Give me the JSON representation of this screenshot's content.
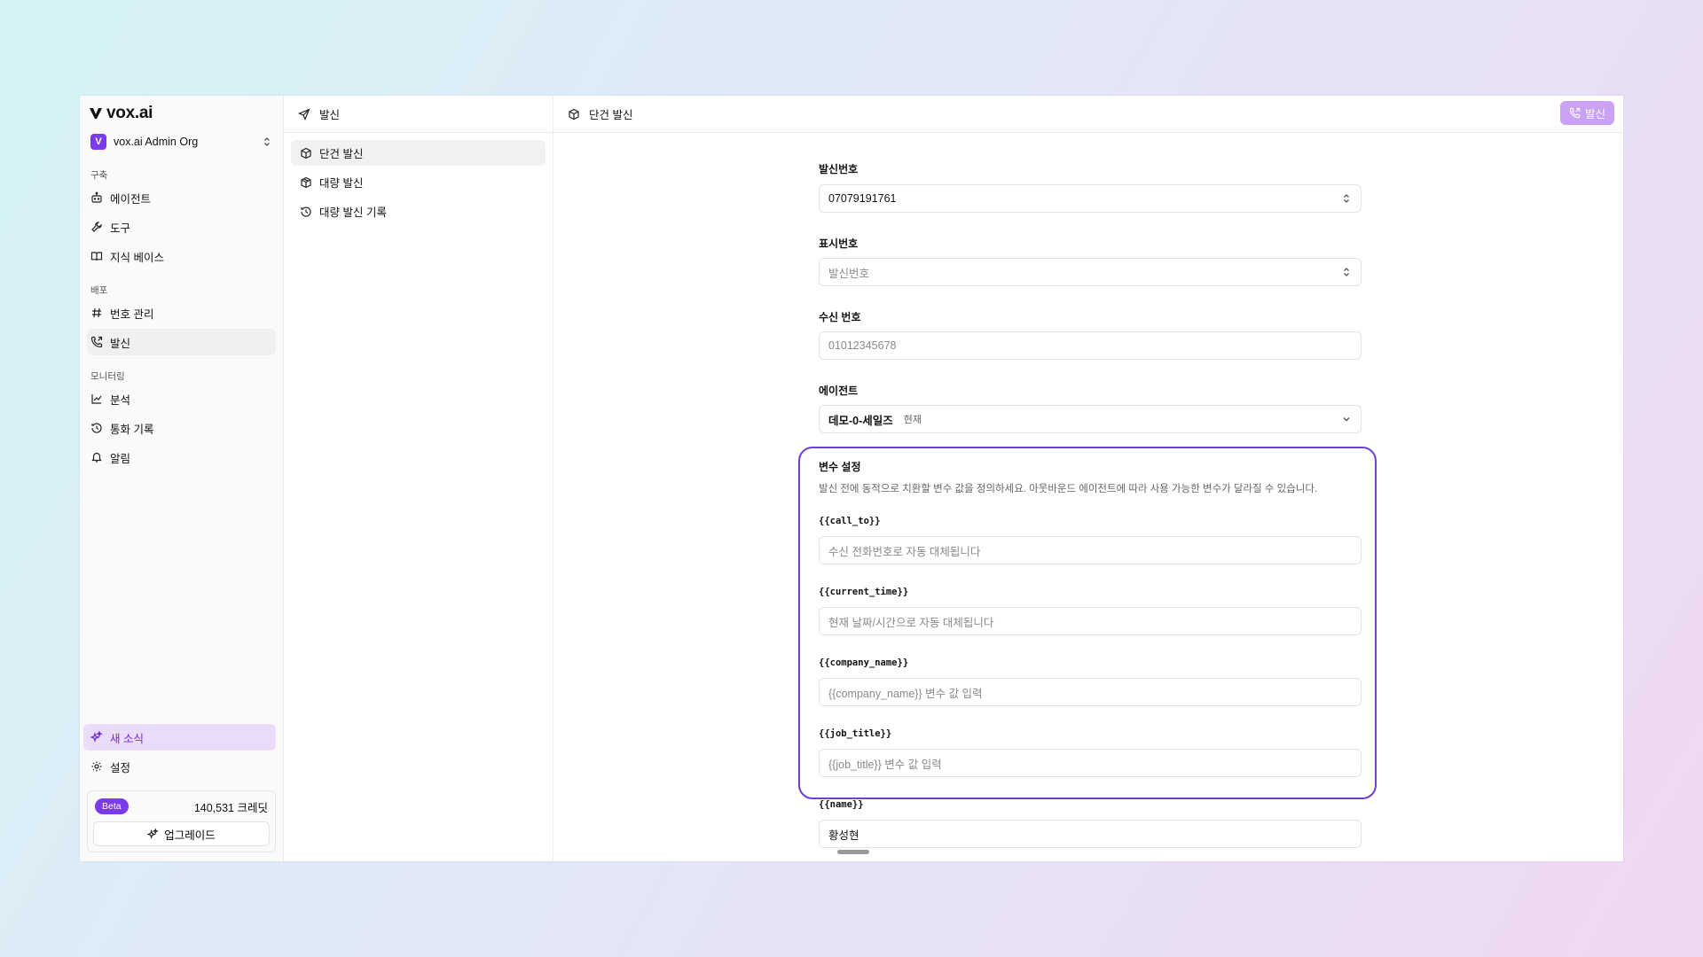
{
  "sidebar": {
    "brand": "vox.ai",
    "org_badge": "V",
    "org_name": "vox.ai Admin Org",
    "sections": [
      {
        "label": "구축",
        "items": [
          {
            "label": "에이전트",
            "icon": "bot-icon"
          },
          {
            "label": "도구",
            "icon": "wrench-icon"
          },
          {
            "label": "지식 베이스",
            "icon": "book-icon"
          }
        ]
      },
      {
        "label": "배포",
        "items": [
          {
            "label": "번호 관리",
            "icon": "hash-icon"
          },
          {
            "label": "발신",
            "icon": "phone-outgoing-icon",
            "active": true
          }
        ]
      },
      {
        "label": "모니터링",
        "items": [
          {
            "label": "분석",
            "icon": "chart-line-icon"
          },
          {
            "label": "통화 기록",
            "icon": "history-icon"
          },
          {
            "label": "알림",
            "icon": "bell-icon"
          }
        ]
      }
    ],
    "news_label": "새 소식",
    "settings_label": "설정",
    "beta_label": "Beta",
    "credits": "140,531 크레딧",
    "upgrade_label": "업그레이드"
  },
  "subpanel": {
    "title": "발신",
    "items": [
      {
        "label": "단건 발신",
        "icon": "box-icon",
        "active": true
      },
      {
        "label": "대량 발신",
        "icon": "boxes-icon"
      },
      {
        "label": "대량 발신 기록",
        "icon": "history-icon"
      }
    ]
  },
  "main": {
    "title": "단건 발신",
    "send_button": "발신",
    "fields": {
      "caller_number": {
        "label": "발신번호",
        "value": "07079191761"
      },
      "display_number": {
        "label": "표시번호",
        "placeholder": "발신번호"
      },
      "recipient_number": {
        "label": "수신 번호",
        "placeholder": "01012345678"
      },
      "agent": {
        "label": "에이전트",
        "value": "데모-0-세일즈",
        "sub": "현재"
      }
    },
    "variables": {
      "title": "변수 설정",
      "description": "발신 전에 동적으로 치환할 변수 값을 정의하세요. 아웃바운드 에이전트에 따라 사용 가능한 변수가 달라질 수 있습니다.",
      "items": [
        {
          "label": "{{call_to}}",
          "placeholder": "수신 전화번호로 자동 대체됩니다"
        },
        {
          "label": "{{current_time}}",
          "placeholder": "현재 날짜/시간으로 자동 대체됩니다"
        },
        {
          "label": "{{company_name}}",
          "placeholder": "{{company_name}} 변수 값 입력"
        },
        {
          "label": "{{job_title}}",
          "placeholder": "{{job_title}} 변수 값 입력"
        },
        {
          "label": "{{name}}",
          "value": "황성현"
        }
      ]
    }
  },
  "colors": {
    "accent": "#7c3aed",
    "accent_soft": "#ecdcfb",
    "send_button_bg": "#c9a2f6",
    "highlight_border": "#6d3fd8"
  }
}
